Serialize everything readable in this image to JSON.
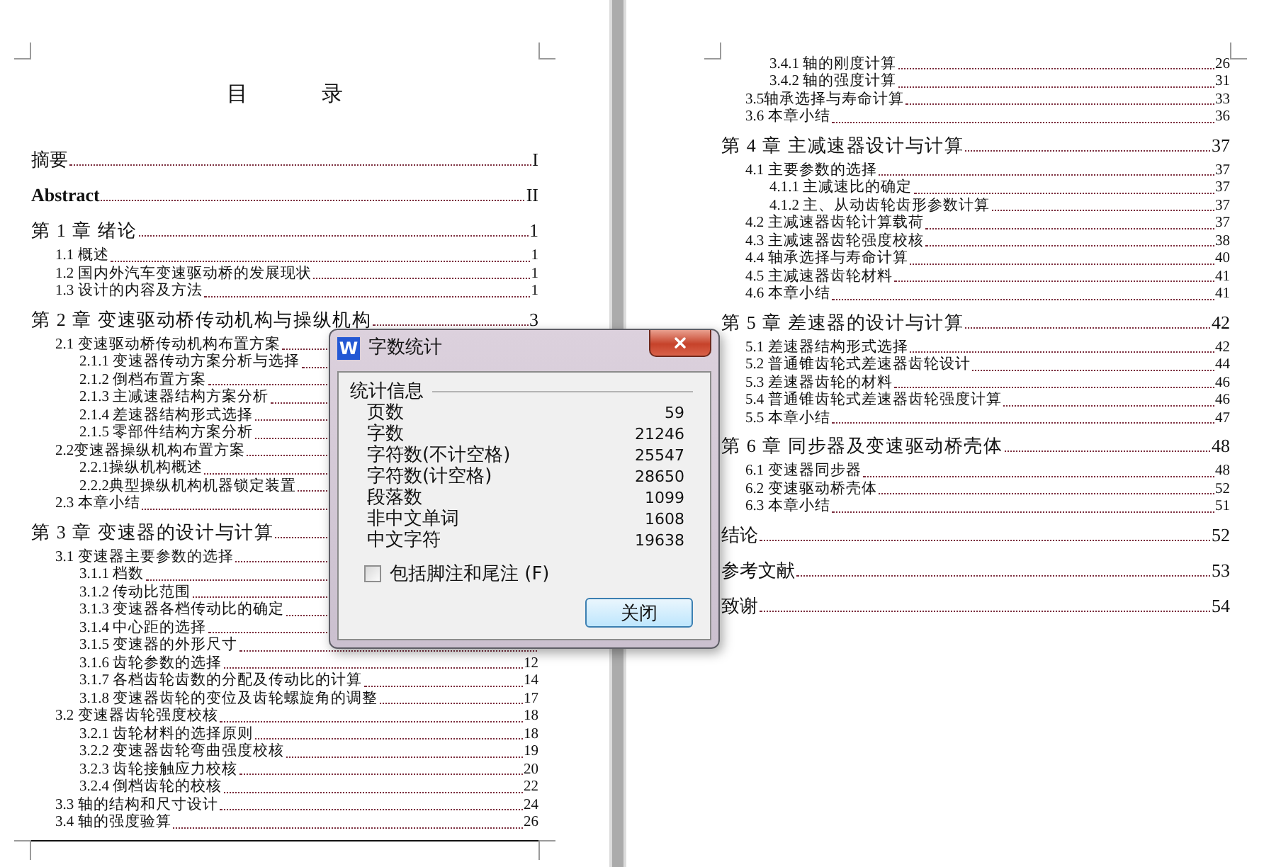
{
  "left_page": {
    "title": "目 录",
    "entries": [
      {
        "label": "摘要",
        "page": "I",
        "kind": "front"
      },
      {
        "label": "Abstract",
        "page": "II",
        "kind": "front",
        "bold": true
      },
      {
        "label": "第 1 章  绪论",
        "page": "1",
        "kind": "chapter",
        "children": [
          {
            "label": "1.1 概述",
            "page": "1"
          },
          {
            "label": "1.2 国内外汽车变速驱动桥的发展现状",
            "page": "1"
          },
          {
            "label": "1.3 设计的内容及方法",
            "page": "1"
          }
        ]
      },
      {
        "label": "第 2 章  变速驱动桥传动机构与操纵机构",
        "page": "3",
        "kind": "chapter",
        "children": [
          {
            "label": "2.1 变速驱动桥传动机构布置方案",
            "children": [
              {
                "label": "2.1.1 变速器传动方案分析与选择"
              },
              {
                "label": "2.1.2 倒档布置方案"
              },
              {
                "label": "2.1.3 主减速器结构方案分析"
              },
              {
                "label": "2.1.4 差速器结构形式选择"
              },
              {
                "label": "2.1.5 零部件结构方案分析"
              }
            ]
          },
          {
            "label": "2.2变速器操纵机构布置方案",
            "children": [
              {
                "label": "2.2.1操纵机构概述"
              },
              {
                "label": "2.2.2典型操纵机构机器锁定装置"
              }
            ]
          },
          {
            "label": "2.3 本章小结"
          }
        ]
      },
      {
        "label": "第 3 章  变速器的设计与计算",
        "kind": "chapter",
        "children": [
          {
            "label": "3.1 变速器主要参数的选择",
            "children": [
              {
                "label": "3.1.1 档数"
              },
              {
                "label": "3.1.2 传动比范围"
              },
              {
                "label": "3.1.3 变速器各档传动比的确定"
              },
              {
                "label": "3.1.4 中心距的选择"
              },
              {
                "label": "3.1.5 变速器的外形尺寸"
              },
              {
                "label": "3.1.6 齿轮参数的选择",
                "page": "12"
              },
              {
                "label": "3.1.7 各档齿轮齿数的分配及传动比的计算",
                "page": "14"
              },
              {
                "label": "3.1.8 变速器齿轮的变位及齿轮螺旋角的调整",
                "page": "17"
              }
            ]
          },
          {
            "label": "3.2 变速器齿轮强度校核",
            "page": "18",
            "children": [
              {
                "label": "3.2.1 齿轮材料的选择原则",
                "page": "18"
              },
              {
                "label": "3.2.2 变速器齿轮弯曲强度校核",
                "page": "19"
              },
              {
                "label": "3.2.3 齿轮接触应力校核",
                "page": "20"
              },
              {
                "label": "3.2.4 倒档齿轮的校核",
                "page": "22"
              }
            ]
          },
          {
            "label": "3.3 轴的结构和尺寸设计",
            "page": "24"
          },
          {
            "label": "3.4 轴的强度验算",
            "page": "26"
          }
        ]
      }
    ]
  },
  "right_page": {
    "entries": [
      {
        "children": [
          {
            "children": [
              {
                "label": "3.4.1 轴的刚度计算",
                "page": "26"
              },
              {
                "label": "3.4.2 轴的强度计算",
                "page": "31"
              }
            ]
          },
          {
            "label": "3.5轴承选择与寿命计算",
            "page": "33"
          },
          {
            "label": "3.6 本章小结",
            "page": "36"
          }
        ]
      },
      {
        "label": "第 4 章  主减速器设计与计算",
        "page": "37",
        "kind": "chapter",
        "children": [
          {
            "label": "4.1 主要参数的选择",
            "page": "37",
            "children": [
              {
                "label": "4.1.1 主减速比的确定",
                "page": "37"
              },
              {
                "label": "4.1.2 主、从动齿轮齿形参数计算",
                "page": "37"
              }
            ]
          },
          {
            "label": "4.2 主减速器齿轮计算载荷",
            "page": "37"
          },
          {
            "label": "4.3 主减速器齿轮强度校核",
            "page": "38"
          },
          {
            "label": "4.4 轴承选择与寿命计算",
            "page": "40"
          },
          {
            "label": "4.5 主减速器齿轮材料",
            "page": "41"
          },
          {
            "label": "4.6 本章小结",
            "page": "41"
          }
        ]
      },
      {
        "label": "第 5 章  差速器的设计与计算",
        "page": "42",
        "kind": "chapter",
        "children": [
          {
            "label": "5.1 差速器结构形式选择",
            "page": "42"
          },
          {
            "label": "5.2 普通锥齿轮式差速器齿轮设计",
            "page": "44"
          },
          {
            "label": "5.3 差速器齿轮的材料",
            "page": "46"
          },
          {
            "label": "5.4 普通锥齿轮式差速器齿轮强度计算",
            "page": "46"
          },
          {
            "label": "5.5 本章小结",
            "page": "47"
          }
        ]
      },
      {
        "label": "第 6 章  同步器及变速驱动桥壳体",
        "page": "48",
        "kind": "chapter",
        "children": [
          {
            "label": "6.1 变速器同步器",
            "page": "48"
          },
          {
            "label": "6.2 变速驱动桥壳体",
            "page": "52"
          },
          {
            "label": "6.3 本章小结",
            "page": "51"
          }
        ]
      },
      {
        "label": "结论",
        "page": "52",
        "kind": "front"
      },
      {
        "label": "参考文献",
        "page": "53",
        "kind": "front"
      },
      {
        "label": "致谢",
        "page": "54",
        "kind": "front"
      }
    ]
  },
  "dialog": {
    "title": "字数统计",
    "icon_letter": "W",
    "group": "统计信息",
    "stats": [
      {
        "label": "页数",
        "value": "59"
      },
      {
        "label": "字数",
        "value": "21246"
      },
      {
        "label": "字符数(不计空格)",
        "value": "25547"
      },
      {
        "label": "字符数(计空格)",
        "value": "28650"
      },
      {
        "label": "段落数",
        "value": "1099"
      },
      {
        "label": "非中文单词",
        "value": "1608"
      },
      {
        "label": "中文字符",
        "value": "19638"
      }
    ],
    "include_notes": {
      "label": "包括脚注和尾注 (F)",
      "checked": false
    },
    "button": "关闭"
  }
}
